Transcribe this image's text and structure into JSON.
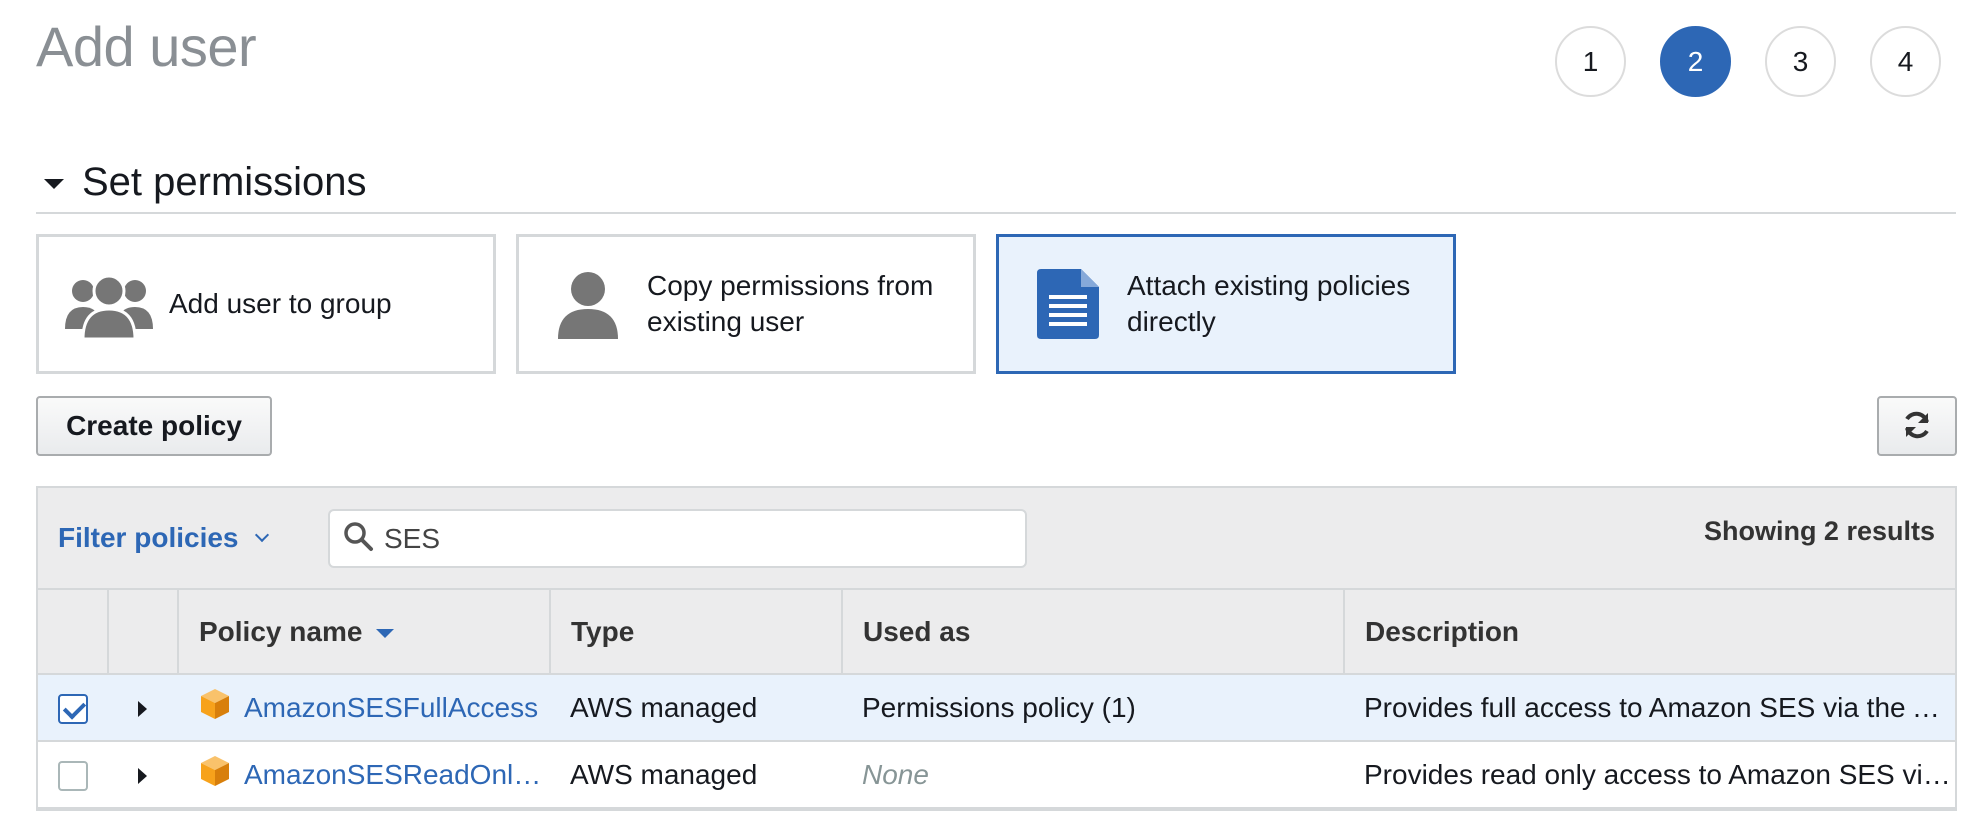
{
  "page": {
    "title": "Add user"
  },
  "steps": [
    {
      "label": "1",
      "active": false
    },
    {
      "label": "2",
      "active": true
    },
    {
      "label": "3",
      "active": false
    },
    {
      "label": "4",
      "active": false
    }
  ],
  "section": {
    "title": "Set permissions"
  },
  "options": [
    {
      "label": "Add user to group",
      "icon": "users-group-icon",
      "selected": false
    },
    {
      "label": "Copy permissions from existing user",
      "icon": "user-icon",
      "selected": false
    },
    {
      "label": "Attach existing policies directly",
      "icon": "document-icon",
      "selected": true
    }
  ],
  "toolbar": {
    "create_policy_label": "Create policy",
    "refresh_icon": "refresh-icon"
  },
  "filter": {
    "label": "Filter policies",
    "search_value": "SES",
    "results_text": "Showing 2 results"
  },
  "table": {
    "columns": [
      "Policy name",
      "Type",
      "Used as",
      "Description"
    ],
    "rows": [
      {
        "checked": true,
        "name": "AmazonSESFullAccess",
        "type": "AWS managed",
        "used_as": "Permissions policy (1)",
        "description": "Provides full access to Amazon SES via the AWS Management Console."
      },
      {
        "checked": false,
        "name": "AmazonSESReadOnlyAccess",
        "type": "AWS managed",
        "used_as": "None",
        "description": "Provides read only access to Amazon SES via the AWS Management Console."
      }
    ]
  },
  "colors": {
    "accent": "#2d67b5",
    "selected_bg": "#e9f2fc",
    "policy_icon": "#f7a21b",
    "icon_gray": "#767676"
  }
}
